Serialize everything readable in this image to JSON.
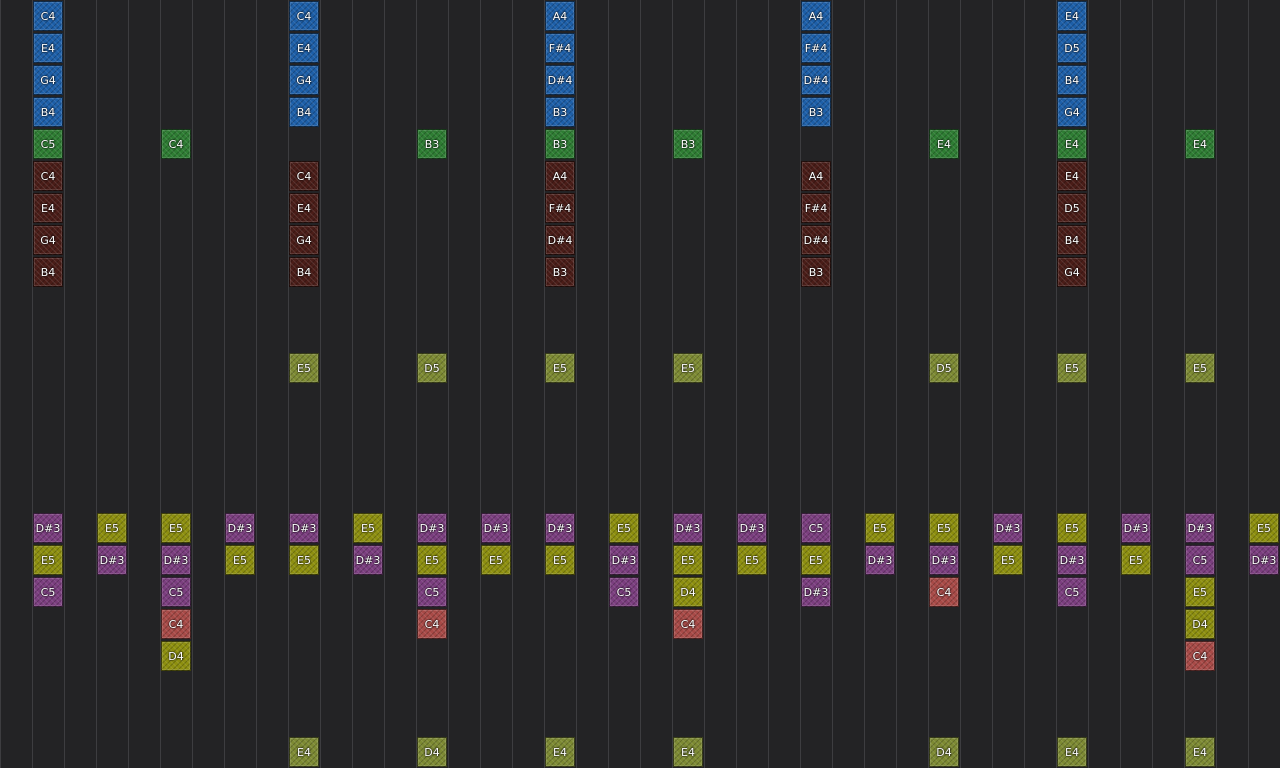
{
  "colors": {
    "background": "#232325",
    "grid_line": "#3d3d40",
    "blue": "#1d5fa8",
    "green": "#2e7d33",
    "maroon": "#4a1d18",
    "olive": "#7d8a33",
    "yellow": "#8d8f0f",
    "purple": "#7b3e7f",
    "salmon": "#a84a47"
  },
  "notes": [
    {
      "col": 1,
      "row": 0,
      "label": "C4",
      "color": "blue"
    },
    {
      "col": 1,
      "row": 1,
      "label": "E4",
      "color": "blue"
    },
    {
      "col": 1,
      "row": 2,
      "label": "G4",
      "color": "blue"
    },
    {
      "col": 1,
      "row": 3,
      "label": "B4",
      "color": "blue"
    },
    {
      "col": 1,
      "row": 4,
      "label": "C5",
      "color": "green"
    },
    {
      "col": 1,
      "row": 5,
      "label": "C4",
      "color": "maroon"
    },
    {
      "col": 1,
      "row": 6,
      "label": "E4",
      "color": "maroon"
    },
    {
      "col": 1,
      "row": 7,
      "label": "G4",
      "color": "maroon"
    },
    {
      "col": 1,
      "row": 8,
      "label": "B4",
      "color": "maroon"
    },
    {
      "col": 1,
      "row": 16,
      "label": "D#3",
      "color": "purple"
    },
    {
      "col": 1,
      "row": 17,
      "label": "E5",
      "color": "yellow"
    },
    {
      "col": 1,
      "row": 18,
      "label": "C5",
      "color": "purple"
    },
    {
      "col": 3,
      "row": 16,
      "label": "E5",
      "color": "yellow"
    },
    {
      "col": 3,
      "row": 17,
      "label": "D#3",
      "color": "purple"
    },
    {
      "col": 5,
      "row": 4,
      "label": "C4",
      "color": "green"
    },
    {
      "col": 5,
      "row": 16,
      "label": "E5",
      "color": "yellow"
    },
    {
      "col": 5,
      "row": 17,
      "label": "D#3",
      "color": "purple"
    },
    {
      "col": 5,
      "row": 18,
      "label": "C5",
      "color": "purple"
    },
    {
      "col": 5,
      "row": 19,
      "label": "C4",
      "color": "salmon"
    },
    {
      "col": 5,
      "row": 20,
      "label": "D4",
      "color": "yellow"
    },
    {
      "col": 7,
      "row": 16,
      "label": "D#3",
      "color": "purple"
    },
    {
      "col": 7,
      "row": 17,
      "label": "E5",
      "color": "yellow"
    },
    {
      "col": 9,
      "row": 0,
      "label": "C4",
      "color": "blue"
    },
    {
      "col": 9,
      "row": 1,
      "label": "E4",
      "color": "blue"
    },
    {
      "col": 9,
      "row": 2,
      "label": "G4",
      "color": "blue"
    },
    {
      "col": 9,
      "row": 3,
      "label": "B4",
      "color": "blue"
    },
    {
      "col": 9,
      "row": 5,
      "label": "C4",
      "color": "maroon"
    },
    {
      "col": 9,
      "row": 6,
      "label": "E4",
      "color": "maroon"
    },
    {
      "col": 9,
      "row": 7,
      "label": "G4",
      "color": "maroon"
    },
    {
      "col": 9,
      "row": 8,
      "label": "B4",
      "color": "maroon"
    },
    {
      "col": 9,
      "row": 11,
      "label": "E5",
      "color": "olive"
    },
    {
      "col": 9,
      "row": 16,
      "label": "D#3",
      "color": "purple"
    },
    {
      "col": 9,
      "row": 17,
      "label": "E5",
      "color": "yellow"
    },
    {
      "col": 9,
      "row": 23,
      "label": "E4",
      "color": "olive"
    },
    {
      "col": 11,
      "row": 16,
      "label": "E5",
      "color": "yellow"
    },
    {
      "col": 11,
      "row": 17,
      "label": "D#3",
      "color": "purple"
    },
    {
      "col": 13,
      "row": 4,
      "label": "B3",
      "color": "green"
    },
    {
      "col": 13,
      "row": 11,
      "label": "D5",
      "color": "olive"
    },
    {
      "col": 13,
      "row": 16,
      "label": "D#3",
      "color": "purple"
    },
    {
      "col": 13,
      "row": 17,
      "label": "E5",
      "color": "yellow"
    },
    {
      "col": 13,
      "row": 18,
      "label": "C5",
      "color": "purple"
    },
    {
      "col": 13,
      "row": 19,
      "label": "C4",
      "color": "salmon"
    },
    {
      "col": 13,
      "row": 23,
      "label": "D4",
      "color": "olive"
    },
    {
      "col": 15,
      "row": 16,
      "label": "D#3",
      "color": "purple"
    },
    {
      "col": 15,
      "row": 17,
      "label": "E5",
      "color": "yellow"
    },
    {
      "col": 17,
      "row": 0,
      "label": "A4",
      "color": "blue"
    },
    {
      "col": 17,
      "row": 1,
      "label": "F#4",
      "color": "blue"
    },
    {
      "col": 17,
      "row": 2,
      "label": "D#4",
      "color": "blue"
    },
    {
      "col": 17,
      "row": 3,
      "label": "B3",
      "color": "blue"
    },
    {
      "col": 17,
      "row": 4,
      "label": "B3",
      "color": "green"
    },
    {
      "col": 17,
      "row": 5,
      "label": "A4",
      "color": "maroon"
    },
    {
      "col": 17,
      "row": 6,
      "label": "F#4",
      "color": "maroon"
    },
    {
      "col": 17,
      "row": 7,
      "label": "D#4",
      "color": "maroon"
    },
    {
      "col": 17,
      "row": 8,
      "label": "B3",
      "color": "maroon"
    },
    {
      "col": 17,
      "row": 11,
      "label": "E5",
      "color": "olive"
    },
    {
      "col": 17,
      "row": 16,
      "label": "D#3",
      "color": "purple"
    },
    {
      "col": 17,
      "row": 17,
      "label": "E5",
      "color": "yellow"
    },
    {
      "col": 17,
      "row": 23,
      "label": "E4",
      "color": "olive"
    },
    {
      "col": 19,
      "row": 16,
      "label": "E5",
      "color": "yellow"
    },
    {
      "col": 19,
      "row": 17,
      "label": "D#3",
      "color": "purple"
    },
    {
      "col": 19,
      "row": 18,
      "label": "C5",
      "color": "purple"
    },
    {
      "col": 21,
      "row": 4,
      "label": "B3",
      "color": "green"
    },
    {
      "col": 21,
      "row": 11,
      "label": "E5",
      "color": "olive"
    },
    {
      "col": 21,
      "row": 16,
      "label": "D#3",
      "color": "purple"
    },
    {
      "col": 21,
      "row": 17,
      "label": "E5",
      "color": "yellow"
    },
    {
      "col": 21,
      "row": 18,
      "label": "D4",
      "color": "yellow"
    },
    {
      "col": 21,
      "row": 19,
      "label": "C4",
      "color": "salmon"
    },
    {
      "col": 21,
      "row": 23,
      "label": "E4",
      "color": "olive"
    },
    {
      "col": 23,
      "row": 16,
      "label": "D#3",
      "color": "purple"
    },
    {
      "col": 23,
      "row": 17,
      "label": "E5",
      "color": "yellow"
    },
    {
      "col": 25,
      "row": 0,
      "label": "A4",
      "color": "blue"
    },
    {
      "col": 25,
      "row": 1,
      "label": "F#4",
      "color": "blue"
    },
    {
      "col": 25,
      "row": 2,
      "label": "D#4",
      "color": "blue"
    },
    {
      "col": 25,
      "row": 3,
      "label": "B3",
      "color": "blue"
    },
    {
      "col": 25,
      "row": 5,
      "label": "A4",
      "color": "maroon"
    },
    {
      "col": 25,
      "row": 6,
      "label": "F#4",
      "color": "maroon"
    },
    {
      "col": 25,
      "row": 7,
      "label": "D#4",
      "color": "maroon"
    },
    {
      "col": 25,
      "row": 8,
      "label": "B3",
      "color": "maroon"
    },
    {
      "col": 25,
      "row": 16,
      "label": "C5",
      "color": "purple"
    },
    {
      "col": 25,
      "row": 17,
      "label": "E5",
      "color": "yellow"
    },
    {
      "col": 25,
      "row": 18,
      "label": "D#3",
      "color": "purple"
    },
    {
      "col": 27,
      "row": 16,
      "label": "E5",
      "color": "yellow"
    },
    {
      "col": 27,
      "row": 17,
      "label": "D#3",
      "color": "purple"
    },
    {
      "col": 29,
      "row": 4,
      "label": "E4",
      "color": "green"
    },
    {
      "col": 29,
      "row": 11,
      "label": "D5",
      "color": "olive"
    },
    {
      "col": 29,
      "row": 16,
      "label": "E5",
      "color": "yellow"
    },
    {
      "col": 29,
      "row": 17,
      "label": "D#3",
      "color": "purple"
    },
    {
      "col": 29,
      "row": 18,
      "label": "C4",
      "color": "salmon"
    },
    {
      "col": 29,
      "row": 23,
      "label": "D4",
      "color": "olive"
    },
    {
      "col": 31,
      "row": 16,
      "label": "D#3",
      "color": "purple"
    },
    {
      "col": 31,
      "row": 17,
      "label": "E5",
      "color": "yellow"
    },
    {
      "col": 33,
      "row": 0,
      "label": "E4",
      "color": "blue"
    },
    {
      "col": 33,
      "row": 1,
      "label": "D5",
      "color": "blue"
    },
    {
      "col": 33,
      "row": 2,
      "label": "B4",
      "color": "blue"
    },
    {
      "col": 33,
      "row": 3,
      "label": "G4",
      "color": "blue"
    },
    {
      "col": 33,
      "row": 4,
      "label": "E4",
      "color": "green"
    },
    {
      "col": 33,
      "row": 5,
      "label": "E4",
      "color": "maroon"
    },
    {
      "col": 33,
      "row": 6,
      "label": "D5",
      "color": "maroon"
    },
    {
      "col": 33,
      "row": 7,
      "label": "B4",
      "color": "maroon"
    },
    {
      "col": 33,
      "row": 8,
      "label": "G4",
      "color": "maroon"
    },
    {
      "col": 33,
      "row": 11,
      "label": "E5",
      "color": "olive"
    },
    {
      "col": 33,
      "row": 16,
      "label": "E5",
      "color": "yellow"
    },
    {
      "col": 33,
      "row": 17,
      "label": "D#3",
      "color": "purple"
    },
    {
      "col": 33,
      "row": 18,
      "label": "C5",
      "color": "purple"
    },
    {
      "col": 33,
      "row": 23,
      "label": "E4",
      "color": "olive"
    },
    {
      "col": 35,
      "row": 16,
      "label": "D#3",
      "color": "purple"
    },
    {
      "col": 35,
      "row": 17,
      "label": "E5",
      "color": "yellow"
    },
    {
      "col": 37,
      "row": 4,
      "label": "E4",
      "color": "green"
    },
    {
      "col": 37,
      "row": 11,
      "label": "E5",
      "color": "olive"
    },
    {
      "col": 37,
      "row": 16,
      "label": "D#3",
      "color": "purple"
    },
    {
      "col": 37,
      "row": 17,
      "label": "C5",
      "color": "purple"
    },
    {
      "col": 37,
      "row": 18,
      "label": "E5",
      "color": "yellow"
    },
    {
      "col": 37,
      "row": 19,
      "label": "D4",
      "color": "yellow"
    },
    {
      "col": 37,
      "row": 20,
      "label": "C4",
      "color": "salmon"
    },
    {
      "col": 37,
      "row": 23,
      "label": "E4",
      "color": "olive"
    },
    {
      "col": 39,
      "row": 16,
      "label": "E5",
      "color": "yellow"
    },
    {
      "col": 39,
      "row": 17,
      "label": "D#3",
      "color": "purple"
    }
  ]
}
